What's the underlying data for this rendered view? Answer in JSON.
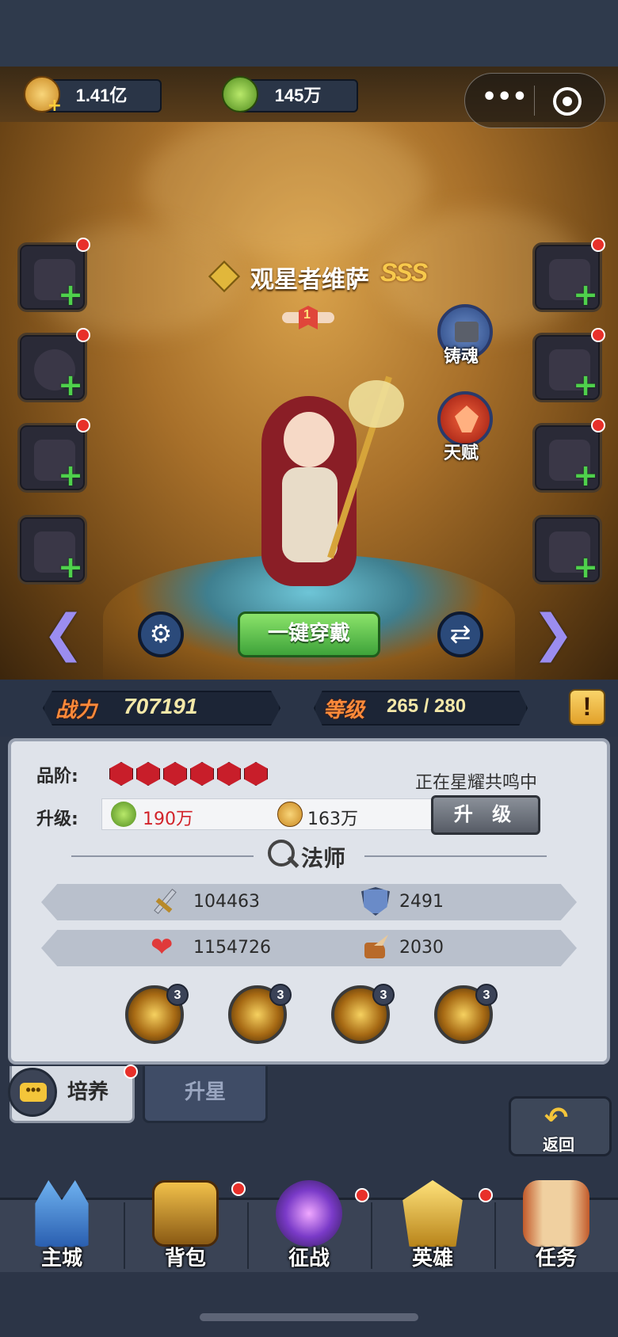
{
  "currency": {
    "gold": "1.41亿",
    "exp_orbs": "145万"
  },
  "hero": {
    "name": "观星者维萨",
    "rank": "SSS",
    "star_level": "1",
    "forge_label": "铸魂",
    "talent_label": "天赋",
    "class_name": "法师",
    "resonance_status": "正在星耀共鸣中"
  },
  "actions": {
    "equip_all": "一键穿戴"
  },
  "stats": {
    "power_label": "战力",
    "power_value": "707191",
    "level_label": "等级",
    "level_value": "265 / 280"
  },
  "panel": {
    "grade_label": "品阶:",
    "grade_gems": 6,
    "upgrade_label": "升级:",
    "orb_cost": "190万",
    "gold_cost": "163万",
    "upgrade_button": "升 级",
    "attack": "104463",
    "defense": "2491",
    "hp": "1154726",
    "speed": "2030",
    "ability_levels": [
      "3",
      "3",
      "3",
      "3"
    ]
  },
  "tabs": {
    "cultivate": "培养",
    "star_up": "升星"
  },
  "back_label": "返回",
  "nav": [
    {
      "label": "主城",
      "badge": false
    },
    {
      "label": "背包",
      "badge": true
    },
    {
      "label": "征战",
      "badge": true
    },
    {
      "label": "英雄",
      "badge": true
    },
    {
      "label": "任务",
      "badge": false
    }
  ],
  "colors": {
    "accent_green": "#4fd14c",
    "accent_orange": "#ff8a3a",
    "badge_red": "#e8302a",
    "gem_red": "#c81e2a"
  }
}
